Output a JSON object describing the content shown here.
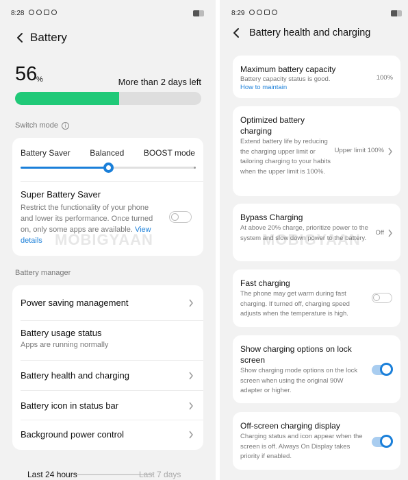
{
  "left": {
    "status_time": "8:28",
    "title": "Battery",
    "battery_percent": "56",
    "percent_sign": "%",
    "battery_level": 0.56,
    "time_left": "More than 2 days left",
    "switch_mode_label": "Switch mode",
    "modes": [
      "Battery Saver",
      "Balanced",
      "BOOST mode"
    ],
    "selected_mode": "Balanced",
    "super_saver_title": "Super Battery Saver",
    "super_saver_desc": "Restrict the functionality of your phone and lower its performance. Once turned on, only some apps are available.",
    "super_saver_link": "View details",
    "super_saver_on": false,
    "battery_manager_label": "Battery manager",
    "manager_items": [
      {
        "title": "Power saving management",
        "subtitle": ""
      },
      {
        "title": "Battery usage status",
        "subtitle": "Apps are running normally"
      },
      {
        "title": "Battery health and charging",
        "subtitle": ""
      },
      {
        "title": "Battery icon in status bar",
        "subtitle": ""
      },
      {
        "title": "Background power control",
        "subtitle": ""
      }
    ],
    "tabs": [
      "Last 24 hours",
      "Last 7 days"
    ],
    "watermark": "MOBIGYAAN"
  },
  "right": {
    "status_time": "8:29",
    "title": "Battery health and charging",
    "items": [
      {
        "title": "Maximum battery capacity",
        "desc": "Battery capacity status is good.",
        "link": "How to maintain",
        "value": "100%"
      },
      {
        "title": "Optimized battery charging",
        "desc": "Extend battery life by reducing the charging upper limit or tailoring charging to your habits when the upper limit is 100%.",
        "value": "Upper limit 100%"
      },
      {
        "title": "Bypass Charging",
        "desc": "At above 20% charge, prioritize power to the system and slow down power to the battery.",
        "value": "Off"
      },
      {
        "title": "Fast charging",
        "desc": "The phone may get warm during fast charging. If turned off, charging speed adjusts when the temperature is high.",
        "toggle": false
      },
      {
        "title": "Show charging options on lock screen",
        "desc": "Show charging mode options on the lock screen when using the original 90W adapter or higher.",
        "toggle": true
      },
      {
        "title": "Off-screen charging display",
        "desc": "Charging status and icon appear when the screen is off. Always On Display takes priority if enabled.",
        "toggle": true
      }
    ],
    "watermark": "MOBIGYAAN"
  }
}
